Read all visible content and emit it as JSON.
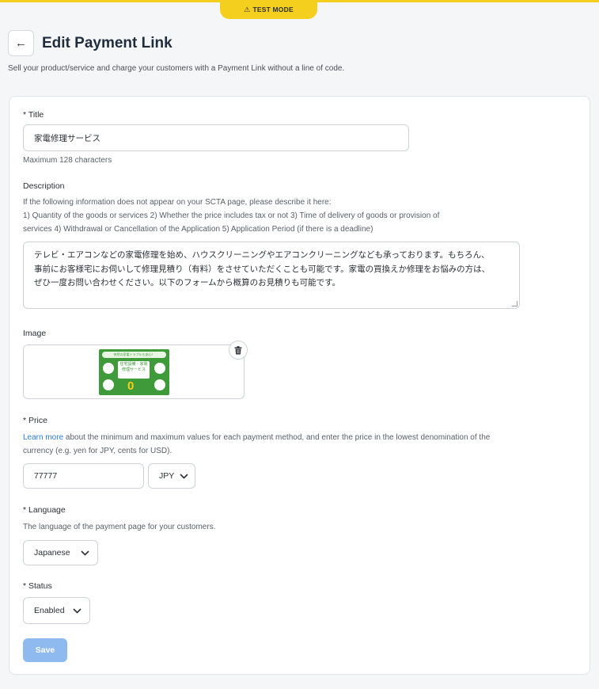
{
  "banner": {
    "label": "TEST MODE",
    "icon": "warning-icon",
    "color": "#f5cf1d"
  },
  "header": {
    "back_icon": "arrow-left-icon",
    "title": "Edit Payment Link"
  },
  "subtitle": "Sell your product/service and charge your customers with a Payment Link without a line of code.",
  "form": {
    "title": {
      "label": "* Title",
      "value": "家電修理サービス",
      "help": "Maximum 128 characters"
    },
    "description": {
      "label": "Description",
      "help_line1": "If the following information does not appear on your SCTA page, please describe it here:",
      "help_line2": "1) Quantity of the goods or services 2) Whether the price includes tax or not 3) Time of delivery of goods or provision of",
      "help_line3": "services 4) Withdrawal or Cancellation of the Application 5) Application Period (if there is a deadline)",
      "value_line1": "テレビ・エアコンなどの家電修理を始め、ハウスクリーニングやエアコンクリーニングなども承っております。もちろん、",
      "value_line2": "事前にお客様宅にお伺いして修理見積り（有料）をさせていただくことも可能です。家電の買換えか修理をお悩みの方は、",
      "value_line3": "ぜひ一度お問い合わせください。以下のフォームから概算のお見積りも可能です。"
    },
    "image": {
      "label": "Image",
      "delete_icon": "trash-icon",
      "thumb_banner": "突然の家電トラブルも安心！",
      "thumb_title_1": "住宅設備・家電",
      "thumb_title_2": "修理サービス",
      "thumb_zero": "0"
    },
    "price": {
      "label": "* Price",
      "link_text": "Learn more",
      "help_rest": " about the minimum and maximum values for each payment method, and enter the price in the lowest denomination of the",
      "help_line2": "currency (e.g. yen for JPY, cents for USD).",
      "value": "77777",
      "currency": "JPY"
    },
    "language": {
      "label": "* Language",
      "help": "The language of the payment page for your customers.",
      "value": "Japanese"
    },
    "status": {
      "label": "* Status",
      "value": "Enabled"
    },
    "save_label": "Save"
  },
  "colors": {
    "accent": "#2f7cd6",
    "save_disabled": "#8fbaf0",
    "thumb_green": "#3f9a3a"
  }
}
